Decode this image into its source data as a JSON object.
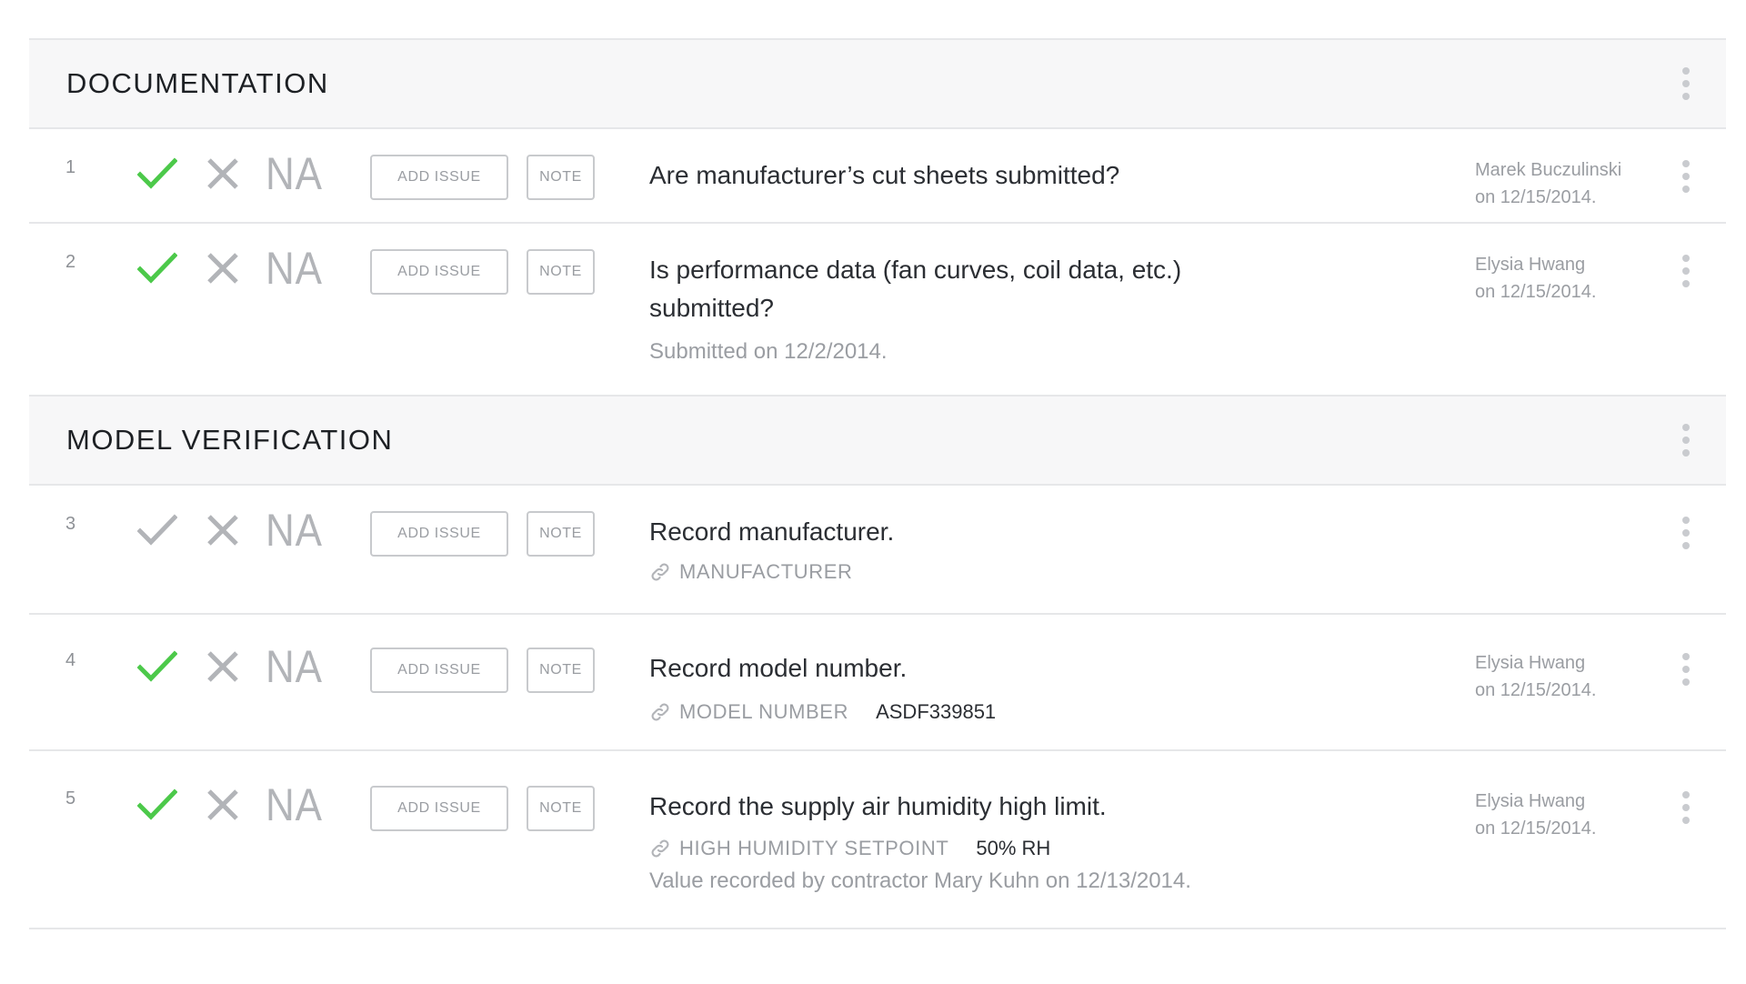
{
  "sections": [
    {
      "title": "DOCUMENTATION",
      "items": [
        {
          "num": "1",
          "status": "pass",
          "add_issue_label": "ADD ISSUE",
          "note_label": "NOTE",
          "na_label": "NA",
          "question": "Are manufacturer’s cut sheets submitted?",
          "author": "Marek Buczulinski",
          "date": "on 12/15/2014."
        },
        {
          "num": "2",
          "status": "pass",
          "add_issue_label": "ADD ISSUE",
          "note_label": "NOTE",
          "na_label": "NA",
          "question": "Is performance data (fan curves, coil data, etc.) submitted?",
          "note": "Submitted on 12/2/2014.",
          "author": "Elysia Hwang",
          "date": "on 12/15/2014."
        }
      ]
    },
    {
      "title": "MODEL VERIFICATION",
      "items": [
        {
          "num": "3",
          "status": "none",
          "add_issue_label": "ADD ISSUE",
          "note_label": "NOTE",
          "na_label": "NA",
          "question": "Record manufacturer.",
          "field_label": "MANUFACTURER",
          "field_value": ""
        },
        {
          "num": "4",
          "status": "pass",
          "add_issue_label": "ADD ISSUE",
          "note_label": "NOTE",
          "na_label": "NA",
          "question": "Record model number.",
          "field_label": "MODEL NUMBER",
          "field_value": "ASDF339851",
          "author": "Elysia Hwang",
          "date": "on 12/15/2014."
        },
        {
          "num": "5",
          "status": "pass",
          "add_issue_label": "ADD ISSUE",
          "note_label": "NOTE",
          "na_label": "NA",
          "question": "Record the supply air humidity high limit.",
          "field_label": "HIGH HUMIDITY SETPOINT",
          "field_value": "50% RH",
          "note": "Value recorded by contractor Mary Kuhn on 12/13/2014.",
          "author": "Elysia Hwang",
          "date": "on 12/15/2014."
        }
      ]
    }
  ],
  "colors": {
    "check_active": "#4cc94a",
    "check_inactive": "#b2b4b8",
    "x_inactive": "#b2b4b8",
    "header_bg": "#f7f7f8",
    "divider": "#e6e7e9"
  },
  "icons": {
    "pass": "check-icon",
    "fail": "x-icon",
    "field": "link-icon",
    "menu": "kebab-menu-icon"
  }
}
